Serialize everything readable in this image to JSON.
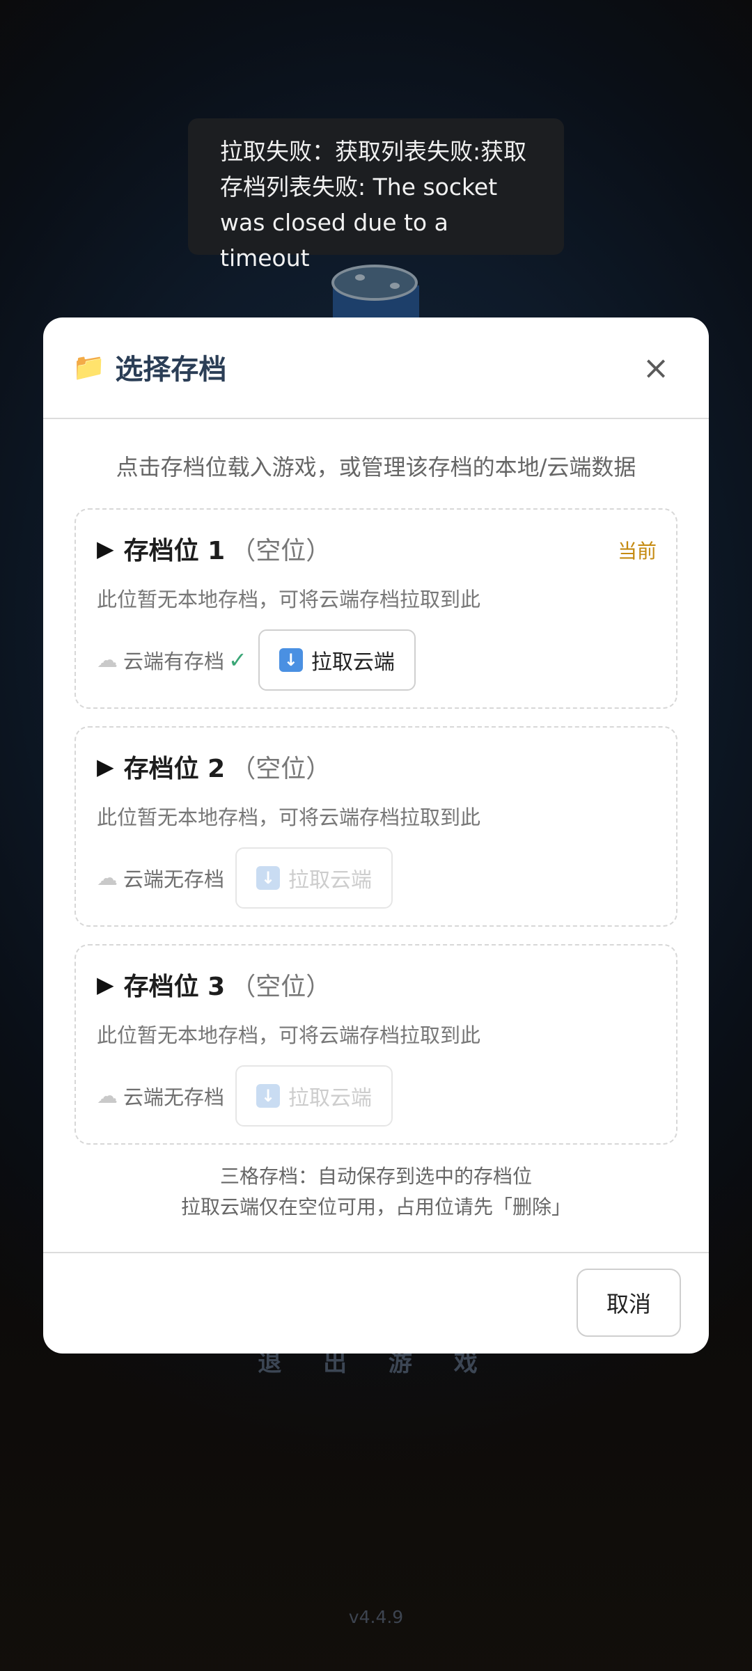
{
  "toast": {
    "message": "拉取失败：获取列表失败:获取存档列表失败: The socket was closed due to a timeout"
  },
  "background": {
    "exit_label": "退 出 游 戏",
    "version": "v4.4.9"
  },
  "dialog": {
    "title": "选择存档",
    "title_icon": "folder-icon",
    "close_label": "×",
    "subtitle": "点击存档位载入游戏，或管理该存档的本地/云端数据",
    "slots": [
      {
        "name": "存档位 1",
        "status": "（空位）",
        "current_tag": "当前",
        "desc": "此位暂无本地存档，可将云端存档拉取到此",
        "cloud_label": "云端有存档",
        "cloud_ok": "✓",
        "pull_label": "拉取云端",
        "pull_enabled": true
      },
      {
        "name": "存档位 2",
        "status": "（空位）",
        "desc": "此位暂无本地存档，可将云端存档拉取到此",
        "cloud_label": "云端无存档",
        "pull_label": "拉取云端",
        "pull_enabled": false
      },
      {
        "name": "存档位 3",
        "status": "（空位）",
        "desc": "此位暂无本地存档，可将云端存档拉取到此",
        "cloud_label": "云端无存档",
        "pull_label": "拉取云端",
        "pull_enabled": false
      }
    ],
    "note_line1": "三格存档：自动保存到选中的存档位",
    "note_line2": "拉取云端仅在空位可用，占用位请先「删除」",
    "cancel_label": "取消"
  },
  "colors": {
    "accent_current": "#c58a10",
    "check_green": "#3aa676",
    "title_color": "#2b3e56"
  }
}
